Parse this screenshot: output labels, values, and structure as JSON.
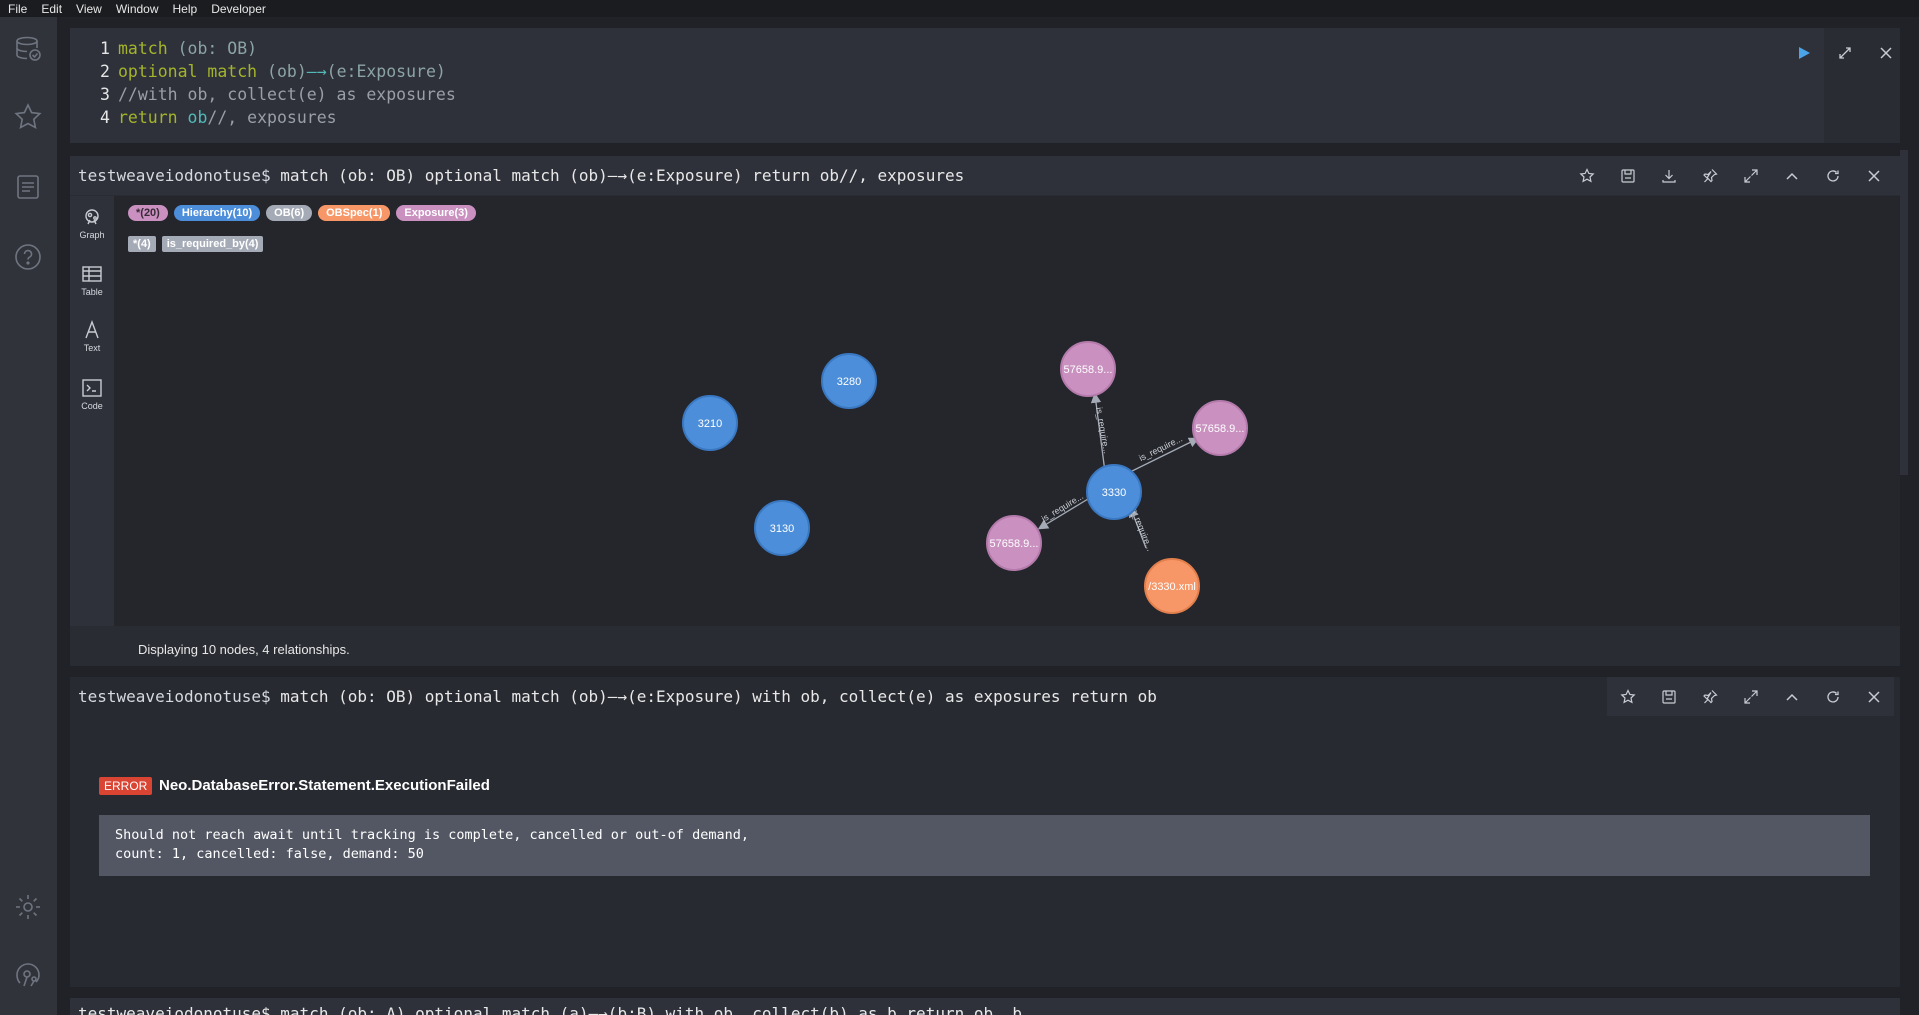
{
  "menu": [
    "File",
    "Edit",
    "View",
    "Window",
    "Help",
    "Developer"
  ],
  "sidebar": {
    "icons": [
      "database-icon",
      "star-icon",
      "document-icon",
      "help-icon",
      "settings-icon",
      "neo4j-icon"
    ]
  },
  "editor": {
    "lines": [
      {
        "num": "1",
        "parts": [
          {
            "cls": "kw",
            "t": "match "
          },
          {
            "cls": "op",
            "t": "(ob: OB)"
          }
        ]
      },
      {
        "num": "2",
        "parts": [
          {
            "cls": "kw",
            "t": "optional match "
          },
          {
            "cls": "op",
            "t": "(ob)"
          },
          {
            "cls": "pat",
            "t": "—→"
          },
          {
            "cls": "op",
            "t": "(e:Exposure)"
          }
        ]
      },
      {
        "num": "3",
        "parts": [
          {
            "cls": "cm",
            "t": "//with ob, collect(e) as exposures"
          }
        ]
      },
      {
        "num": "4",
        "parts": [
          {
            "cls": "kw",
            "t": "return "
          },
          {
            "cls": "pat",
            "t": "ob"
          },
          {
            "cls": "cm",
            "t": "//, exposures"
          }
        ]
      }
    ]
  },
  "frame1": {
    "prompt": "testweaveiodonotuse$",
    "query": " match (ob: OB) optional match (ob)—→(e:Exposure) return ob//, exposures",
    "tabs": [
      "Graph",
      "Table",
      "Text",
      "Code"
    ],
    "node_labels": [
      {
        "text": "*(20)",
        "color": "#c990c0",
        "dark": true
      },
      {
        "text": "Hierarchy(10)",
        "color": "#4c8eda",
        "dark": false
      },
      {
        "text": "OB(6)",
        "color": "#a5abb6",
        "dark": false
      },
      {
        "text": "OBSpec(1)",
        "color": "#f79767",
        "dark": false
      },
      {
        "text": "Exposure(3)",
        "color": "#c990c0",
        "dark": false
      }
    ],
    "rel_labels": [
      "*(4)",
      "is_required_by(4)"
    ],
    "nodes": [
      {
        "id": "3280",
        "color": "#4c8eda"
      },
      {
        "id": "3210",
        "color": "#4c8eda"
      },
      {
        "id": "3130",
        "color": "#4c8eda"
      },
      {
        "id": "3330",
        "color": "#4c8eda"
      },
      {
        "id": "57658.9...",
        "color": "#c990c0"
      },
      {
        "id": "57658.9...",
        "color": "#c990c0"
      },
      {
        "id": "57658.9...",
        "color": "#c990c0"
      },
      {
        "id": "/3330.xml",
        "color": "#f79767"
      }
    ],
    "rel_caption": "is_require...",
    "footer": "Displaying 10 nodes, 4 relationships."
  },
  "frame2": {
    "prompt": "testweaveiodonotuse$",
    "query": " match (ob: OB) optional match (ob)—→(e:Exposure) with ob, collect(e) as exposures return ob",
    "error_badge": "ERROR",
    "error_title": "Neo.DatabaseError.Statement.ExecutionFailed",
    "error_line1": "Should not reach await until tracking is complete, cancelled or out-of demand,",
    "error_line2": "count: 1, cancelled: false, demand: 50"
  },
  "frame3": {
    "partial_title": "testweaveiodonotuse$ match (ob: A) optional match (a)—→(b:B) with ob, collect(b) as b return ob, b"
  }
}
